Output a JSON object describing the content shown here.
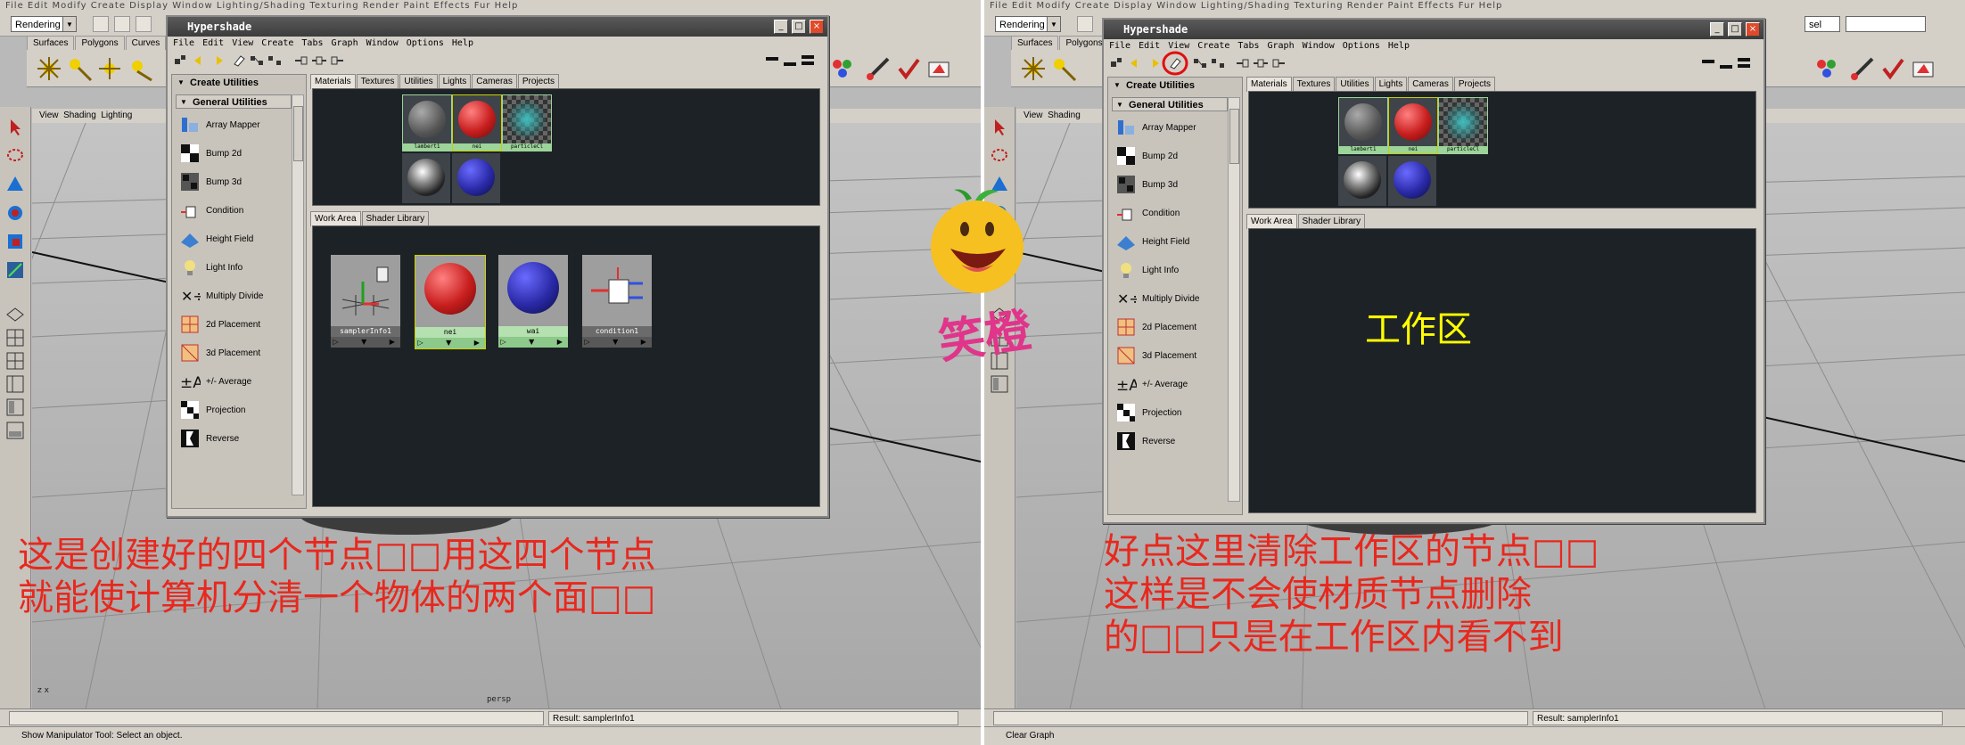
{
  "left": {
    "app_menu": "File  Edit  Modify  Create  Display  Window  Lighting/Shading  Texturing  Render  Paint Effects  Fur  Help",
    "mode_combo": "Rendering",
    "shelf_tabs": [
      "Surfaces",
      "Polygons",
      "Curves"
    ],
    "view_menu": [
      "View",
      "Shading",
      "Lighting"
    ],
    "viewport_label": "persp",
    "axis_label": "z x",
    "result": "Result: samplerInfo1",
    "help_line": "Show Manipulator Tool: Select an object.",
    "annotation_line1": "这是创建好的四个节点□□用这四个节点",
    "annotation_line2": "就能使计算机分清一个物体的两个面□□"
  },
  "right": {
    "app_menu": "File  Edit  Modify  Create  Display  Window  Lighting/Shading  Texturing  Render  Paint Effects  Fur  Help",
    "mode_combo": "Rendering",
    "combo2": "sel",
    "shelf_tabs": [
      "Surfaces",
      "Polygons"
    ],
    "view_menu": [
      "View",
      "Shading"
    ],
    "result": "Result: samplerInfo1",
    "help_line": "Clear Graph",
    "annotation_line1": "好点这里清除工作区的节点□□",
    "annotation_line2": "这样是不会使材质节点删除",
    "annotation_line3": "的□□只是在工作区内看不到",
    "workarea_label": "工作区"
  },
  "hypershade": {
    "title": "Hypershade",
    "menu": [
      "File",
      "Edit",
      "View",
      "Create",
      "Tabs",
      "Graph",
      "Window",
      "Options",
      "Help"
    ],
    "create_utilities": "Create Utilities",
    "general_utilities": "General Utilities",
    "utilities": [
      {
        "label": "Array Mapper",
        "icon": "array-mapper-icon"
      },
      {
        "label": "Bump 2d",
        "icon": "bump2d-icon"
      },
      {
        "label": "Bump 3d",
        "icon": "bump3d-icon"
      },
      {
        "label": "Condition",
        "icon": "condition-icon"
      },
      {
        "label": "Height Field",
        "icon": "height-field-icon"
      },
      {
        "label": "Light Info",
        "icon": "light-info-icon"
      },
      {
        "label": "Multiply Divide",
        "icon": "multiply-divide-icon"
      },
      {
        "label": "2d Placement",
        "icon": "placement2d-icon"
      },
      {
        "label": "3d Placement",
        "icon": "placement3d-icon"
      },
      {
        "label": "+/- Average",
        "icon": "plus-minus-average-icon"
      },
      {
        "label": "Projection",
        "icon": "projection-icon"
      },
      {
        "label": "Reverse",
        "icon": "reverse-icon"
      }
    ],
    "top_tabs": [
      "Materials",
      "Textures",
      "Utilities",
      "Lights",
      "Cameras",
      "Projects"
    ],
    "bottom_tabs": [
      "Work Area",
      "Shader Library"
    ],
    "swatches": [
      {
        "label": "lambert1",
        "color": "#6a6a6a"
      },
      {
        "label": "nei",
        "color": "#c81e1e"
      },
      {
        "label": "particleCl",
        "color": "#1a8a8a"
      }
    ],
    "nodes": [
      {
        "label": "samplerInfo1"
      },
      {
        "label": "nei"
      },
      {
        "label": "wai"
      },
      {
        "label": "condition1"
      }
    ]
  },
  "logo_text": "笑橙"
}
